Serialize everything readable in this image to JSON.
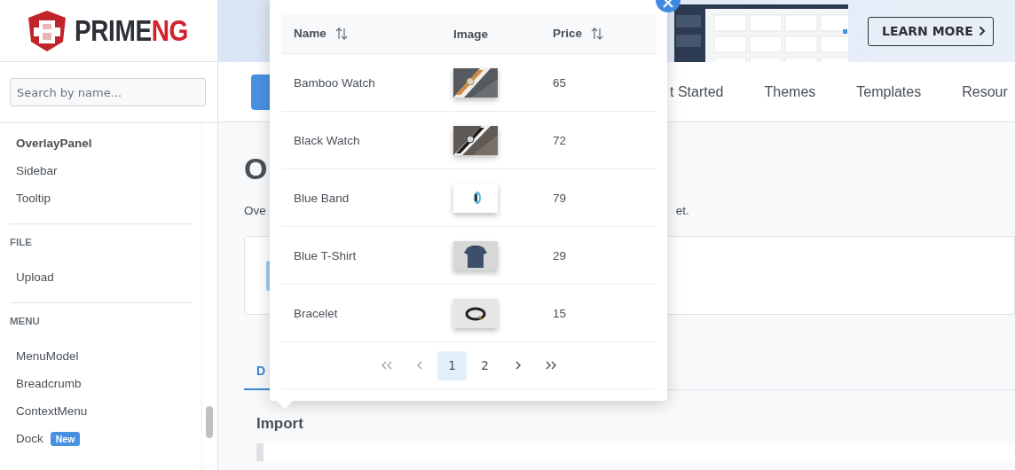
{
  "logo": {
    "text_dark": "PRIME",
    "text_accent": "NG"
  },
  "search": {
    "placeholder": "Search by name..."
  },
  "sidebar": {
    "groups": [
      {
        "items": [
          {
            "label": "OverlayPanel",
            "selected": true
          },
          {
            "label": "Sidebar",
            "selected": false
          },
          {
            "label": "Tooltip",
            "selected": false
          }
        ]
      },
      {
        "heading": "FILE",
        "items": [
          {
            "label": "Upload",
            "selected": false
          }
        ]
      },
      {
        "heading": "MENU",
        "items": [
          {
            "label": "MenuModel",
            "selected": false
          },
          {
            "label": "Breadcrumb",
            "selected": false
          },
          {
            "label": "ContextMenu",
            "selected": false
          },
          {
            "label": "Dock",
            "selected": false,
            "badge": "New"
          }
        ]
      }
    ]
  },
  "banner": {
    "button": "LEARN MORE"
  },
  "nav": {
    "items": [
      "t Started",
      "Themes",
      "Templates",
      "Resour"
    ]
  },
  "page": {
    "title": "O",
    "description_start": "Ove",
    "description_end": "et.",
    "tabs": [
      {
        "label": "D",
        "selected": true
      }
    ],
    "section_heading": "Import"
  },
  "overlay": {
    "columns": [
      {
        "label": "Name",
        "sortable": true
      },
      {
        "label": "Image",
        "sortable": false
      },
      {
        "label": "Price",
        "sortable": true
      }
    ],
    "rows": [
      {
        "name": "Bamboo Watch",
        "price": "65"
      },
      {
        "name": "Black Watch",
        "price": "72"
      },
      {
        "name": "Blue Band",
        "price": "79"
      },
      {
        "name": "Blue T-Shirt",
        "price": "29"
      },
      {
        "name": "Bracelet",
        "price": "15"
      }
    ],
    "paginator": {
      "first_disabled": true,
      "prev_disabled": true,
      "next_disabled": false,
      "last_disabled": false,
      "pages": [
        {
          "label": "1",
          "selected": true
        },
        {
          "label": "2",
          "selected": false
        }
      ]
    }
  }
}
